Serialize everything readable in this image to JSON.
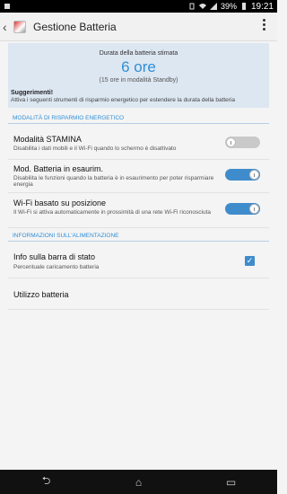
{
  "status_bar": {
    "battery_percent": "39%",
    "time": "19:21",
    "icons": [
      "notification-icon",
      "vibrate-icon",
      "wifi-icon",
      "signal-icon",
      "battery-icon"
    ]
  },
  "action_bar": {
    "title": "Gestione Batteria",
    "back_glyph": "‹",
    "overflow_icon": "overflow-menu-icon"
  },
  "battery_estimate": {
    "label": "Durata della batteria stimata",
    "value": "6 ore",
    "standby": "(15 ore in modalità Standby)"
  },
  "tips": {
    "title": "Suggerimenti!",
    "text": "Attiva i seguenti strumenti di risparmio energetico per estendere la durata della batteria"
  },
  "sections": {
    "energy_saving": "MODALITÀ DI RISPARMIO ENERGETICO",
    "power_info": "INFORMAZIONI SULL'ALIMENTAZIONE"
  },
  "settings": [
    {
      "title": "Modalità STAMINA",
      "subtitle": "Disabilita i dati mobili e il Wi-Fi quando lo schermo è disattivato",
      "state": "off"
    },
    {
      "title": "Mod. Batteria in esaurim.",
      "subtitle": "Disabilita le funzioni quando la batteria è in esaurimento per poter risparmiare energia",
      "state": "on"
    },
    {
      "title": "Wi-Fi basato su posizione",
      "subtitle": "Il Wi-Fi si attiva automaticamente in prossimità di una rete Wi-Fi riconosciuta",
      "state": "on"
    }
  ],
  "power_info": [
    {
      "title": "Info sulla barra di stato",
      "subtitle": "Percentuale caricamento batteria",
      "checked": true
    },
    {
      "title": "Utilizzo batteria"
    }
  ],
  "nav_bar": {
    "back": "⮌",
    "home": "⌂",
    "recents": "▭"
  },
  "colors": {
    "accent": "#2f8fd6",
    "toggle_on": "#3f8ccc",
    "header_bg": "#dde7f2"
  }
}
